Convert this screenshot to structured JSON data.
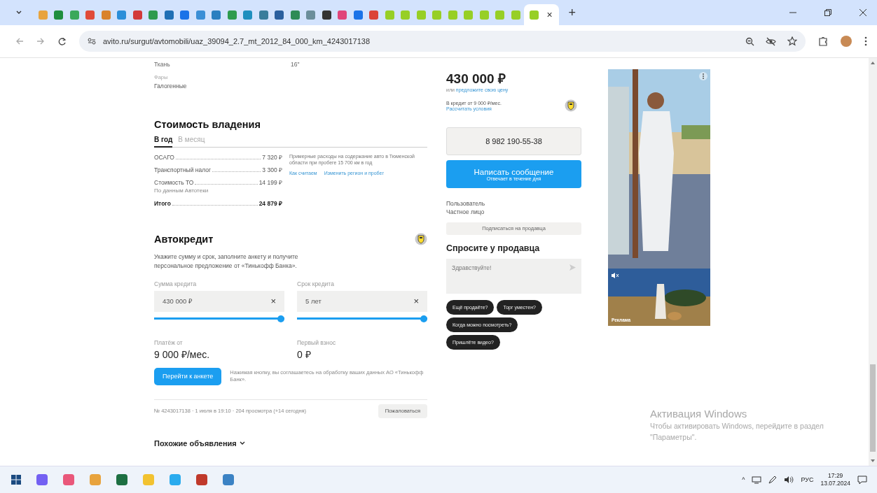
{
  "browser": {
    "tabs": [
      {
        "color": "#e8a33d",
        "selected": false
      },
      {
        "color": "#1e8e3e",
        "selected": false
      },
      {
        "color": "#3aa85a",
        "selected": false
      },
      {
        "color": "#e04a3a",
        "selected": false
      },
      {
        "color": "#d9822b",
        "selected": false
      },
      {
        "color": "#2b8ed9",
        "selected": false
      },
      {
        "color": "#d23a3a",
        "selected": false
      },
      {
        "color": "#2e9b4e",
        "selected": false
      },
      {
        "color": "#1f6fb5",
        "selected": false
      },
      {
        "color": "#1a73e8",
        "selected": false
      },
      {
        "color": "#3b8fd6",
        "selected": false
      },
      {
        "color": "#2a7fc0",
        "selected": false
      },
      {
        "color": "#2e9b4e",
        "selected": false
      },
      {
        "color": "#1f8fbf",
        "selected": false
      },
      {
        "color": "#3a7d9b",
        "selected": false
      },
      {
        "color": "#2a5f9e",
        "selected": false
      },
      {
        "color": "#2e8b57",
        "selected": false
      },
      {
        "color": "#6b8e9b",
        "selected": false
      },
      {
        "color": "#333333",
        "selected": false
      },
      {
        "color": "#e0457b",
        "selected": false
      },
      {
        "color": "#1a73e8",
        "selected": false
      },
      {
        "color": "#db4437",
        "selected": false
      },
      {
        "color": "#97cf26",
        "selected": false
      },
      {
        "color": "#97cf26",
        "selected": false
      },
      {
        "color": "#97cf26",
        "selected": false
      },
      {
        "color": "#97cf26",
        "selected": false
      },
      {
        "color": "#97cf26",
        "selected": false
      },
      {
        "color": "#97cf26",
        "selected": false
      },
      {
        "color": "#97cf26",
        "selected": false
      },
      {
        "color": "#97cf26",
        "selected": false
      },
      {
        "color": "#97cf26",
        "selected": false
      },
      {
        "color": "#97cf26",
        "selected": true
      }
    ],
    "close": "×",
    "new_tab": "+",
    "url": "avito.ru/surgut/avtomobili/uaz_39094_2.7_mt_2012_84_000_km_4243017138"
  },
  "listing": {
    "spec_values": [
      "Ткань",
      "16\""
    ],
    "specs": [
      {
        "label": "Фары",
        "value": "Галогенные"
      }
    ],
    "ownership": {
      "title": "Стоимость владения",
      "tabs": [
        {
          "label": "В год",
          "selected": true
        },
        {
          "label": "В месяц",
          "selected": false
        }
      ],
      "rows": [
        {
          "kind": "item",
          "label": "ОСАГО",
          "value": "7 320 ₽"
        },
        {
          "kind": "item",
          "label": "Транспортный налог",
          "value": "3 300 ₽"
        },
        {
          "kind": "item",
          "label": "Стоимость ТО",
          "value": "14 199 ₽",
          "note": "По данным Автотеки"
        },
        {
          "kind": "total",
          "label": "Итого",
          "value": "24 879 ₽"
        }
      ],
      "note": "Примерные расходы на содержание авто в Тюменской области при пробеге 15 700 км в год",
      "links": [
        "Как считаем",
        "Изменить регион и пробег"
      ]
    },
    "credit": {
      "title": "Автокредит",
      "text": "Укажите сумму и срок, заполните анкету и получите персональное предложение от «Тинькофф Банка».",
      "fields": [
        {
          "label": "Сумма кредита",
          "value": "430 000 ₽",
          "clear": "×",
          "level": 1
        },
        {
          "label": "Срок кредита",
          "value": "5 лет",
          "clear": "×",
          "level": 1
        }
      ],
      "results": [
        {
          "label": "Платёж от",
          "value": "9 000 ₽/мес."
        },
        {
          "label": "Первый взнос",
          "value": "0 ₽"
        }
      ],
      "button": "Перейти к анкете",
      "consent": "Нажимая кнопку, вы соглашаетесь на обработку ваших данных АО «Тинькофф Банк»."
    },
    "meta": "№ 4243017138 · 1 июля в 19:10 · 204 просмотра (+14 сегодня)",
    "report": "Пожаловаться",
    "similar": "Похожие объявления"
  },
  "sidebar": {
    "price": "430 000 ₽",
    "offer_prefix": "или",
    "offer_link": "предложите свою цену",
    "credit_text": "В кредит от 9 000 ₽/мес.",
    "credit_link": "Рассчитать условия",
    "phone": "8 982 190-55-38",
    "message_button": "Написать сообщение",
    "message_sub": "Отвечает в течение дня",
    "seller_role": "Пользователь",
    "seller_type": "Частное лицо",
    "subscribe": "Подписаться на продавца",
    "ask_title": "Спросите у продавца",
    "ask_value": "Здравствуйте!",
    "chips": [
      "Ещё продаёте?",
      "Торг уместен?",
      "Когда можно посмотреть?",
      "Пришлёте видео?"
    ]
  },
  "ad": {
    "label": "Реклама"
  },
  "activation": {
    "title": "Активация Windows",
    "text": "Чтобы активировать Windows, перейдите в раздел \"Параметры\"."
  },
  "taskbar": {
    "apps": [
      {
        "color": "#7360f2"
      },
      {
        "color": "#e9577a"
      },
      {
        "color": "#e8a33d"
      },
      {
        "color": "#1d6f42"
      },
      {
        "color": "#f2c230"
      },
      {
        "color": "#2aabee"
      },
      {
        "color": "#c0392b"
      },
      {
        "color": "#3b82c4"
      }
    ],
    "caret": "^",
    "language": "РУС",
    "time": "17:29",
    "date": "13.07.2024"
  }
}
